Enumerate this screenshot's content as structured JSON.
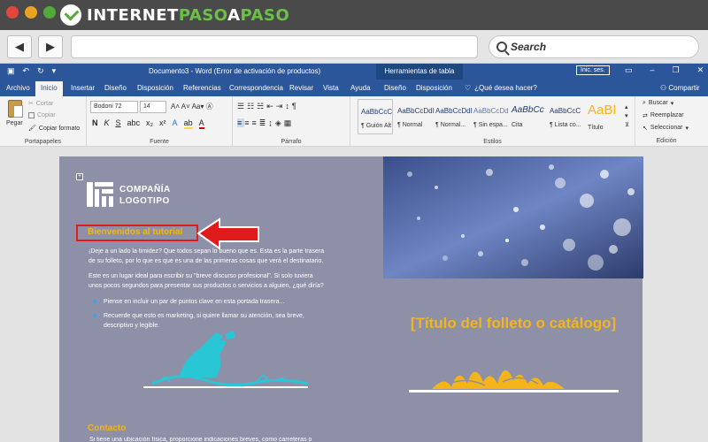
{
  "browser": {
    "brand_prefix": "INTERNET",
    "brand_mid": "PASO",
    "brand_a": "A",
    "brand_suffix": "PASO",
    "back_icon": "◀",
    "forward_icon": "▶",
    "search_label": "Search"
  },
  "word": {
    "doc_title": "Documento3  -  Word (Error de activación de productos)",
    "context_tools": "Herramientas de tabla",
    "sign_in": "Inic. ses.",
    "tabs": [
      "Archivo",
      "Inicio",
      "Insertar",
      "Diseño",
      "Disposición",
      "Referencias",
      "Correspondencia",
      "Revisar",
      "Vista",
      "Ayuda",
      "Diseño",
      "Disposición"
    ],
    "tell_me": "¿Qué desea hacer?",
    "share": "Compartir",
    "clipboard": {
      "paste": "Pegar",
      "cut": "Cortar",
      "copy": "Copiar",
      "format_painter": "Copiar formato",
      "label": "Portapapeles"
    },
    "font": {
      "name": "Bodoni 72",
      "size": "14",
      "label": "Fuente"
    },
    "paragraph_label": "Párrafo",
    "styles": {
      "label": "Estilos",
      "items": [
        {
          "sample": "AaBbCcC",
          "name": "¶ Guión Alt"
        },
        {
          "sample": "AaBbCcDdI",
          "name": "¶ Normal"
        },
        {
          "sample": "AaBbCcDdI",
          "name": "¶ Normal..."
        },
        {
          "sample": "AaBbCcDd",
          "name": "¶ Sin espa..."
        },
        {
          "sample": "AaBbCc",
          "name": "Cita"
        },
        {
          "sample": "AaBbCcC",
          "name": "¶ Lista co..."
        },
        {
          "sample": "AaBI",
          "name": "Título"
        }
      ]
    },
    "editing": {
      "find": "Buscar",
      "replace": "Reemplazar",
      "select": "Seleccionar",
      "label": "Edición"
    }
  },
  "document": {
    "company_line1": "COMPAÑÍA",
    "company_line2": "LOGOTIPO",
    "welcome_heading": "Bienvenidos al tutorial",
    "para1": "¡Deje a un lado la timidez? Que todos sepan lo bueno que es. Esta es la parte trasera de su folleto, por lo que es que es una de las primeras cosas que verá el destinatario.",
    "para2": "Este es un lugar ideal para escribir su \"breve discurso profesional\". Si solo tuviera unos pocos segundos para presentar sus productos o servicios a alguien, ¿qué diría?",
    "bullet1": "Piense en incluir un par de puntos clave en esta portada trasera...",
    "bullet2": "Recuerde que esto es marketing, si quiere llamar su atención, sea breve, descriptivo y legible.",
    "contact_heading": "Contacto",
    "contact_text": "Si tiene una ubicación física, proporcione indicaciones breves, como carreteras o",
    "cover_title": "[Título del folleto o catálogo]"
  },
  "colors": {
    "word_blue": "#2b579a",
    "accent_yellow": "#f4b41a",
    "highlight_red": "#e01b1b",
    "page_bg": "#8e90a7",
    "illustration_teal": "#29c6d6"
  }
}
